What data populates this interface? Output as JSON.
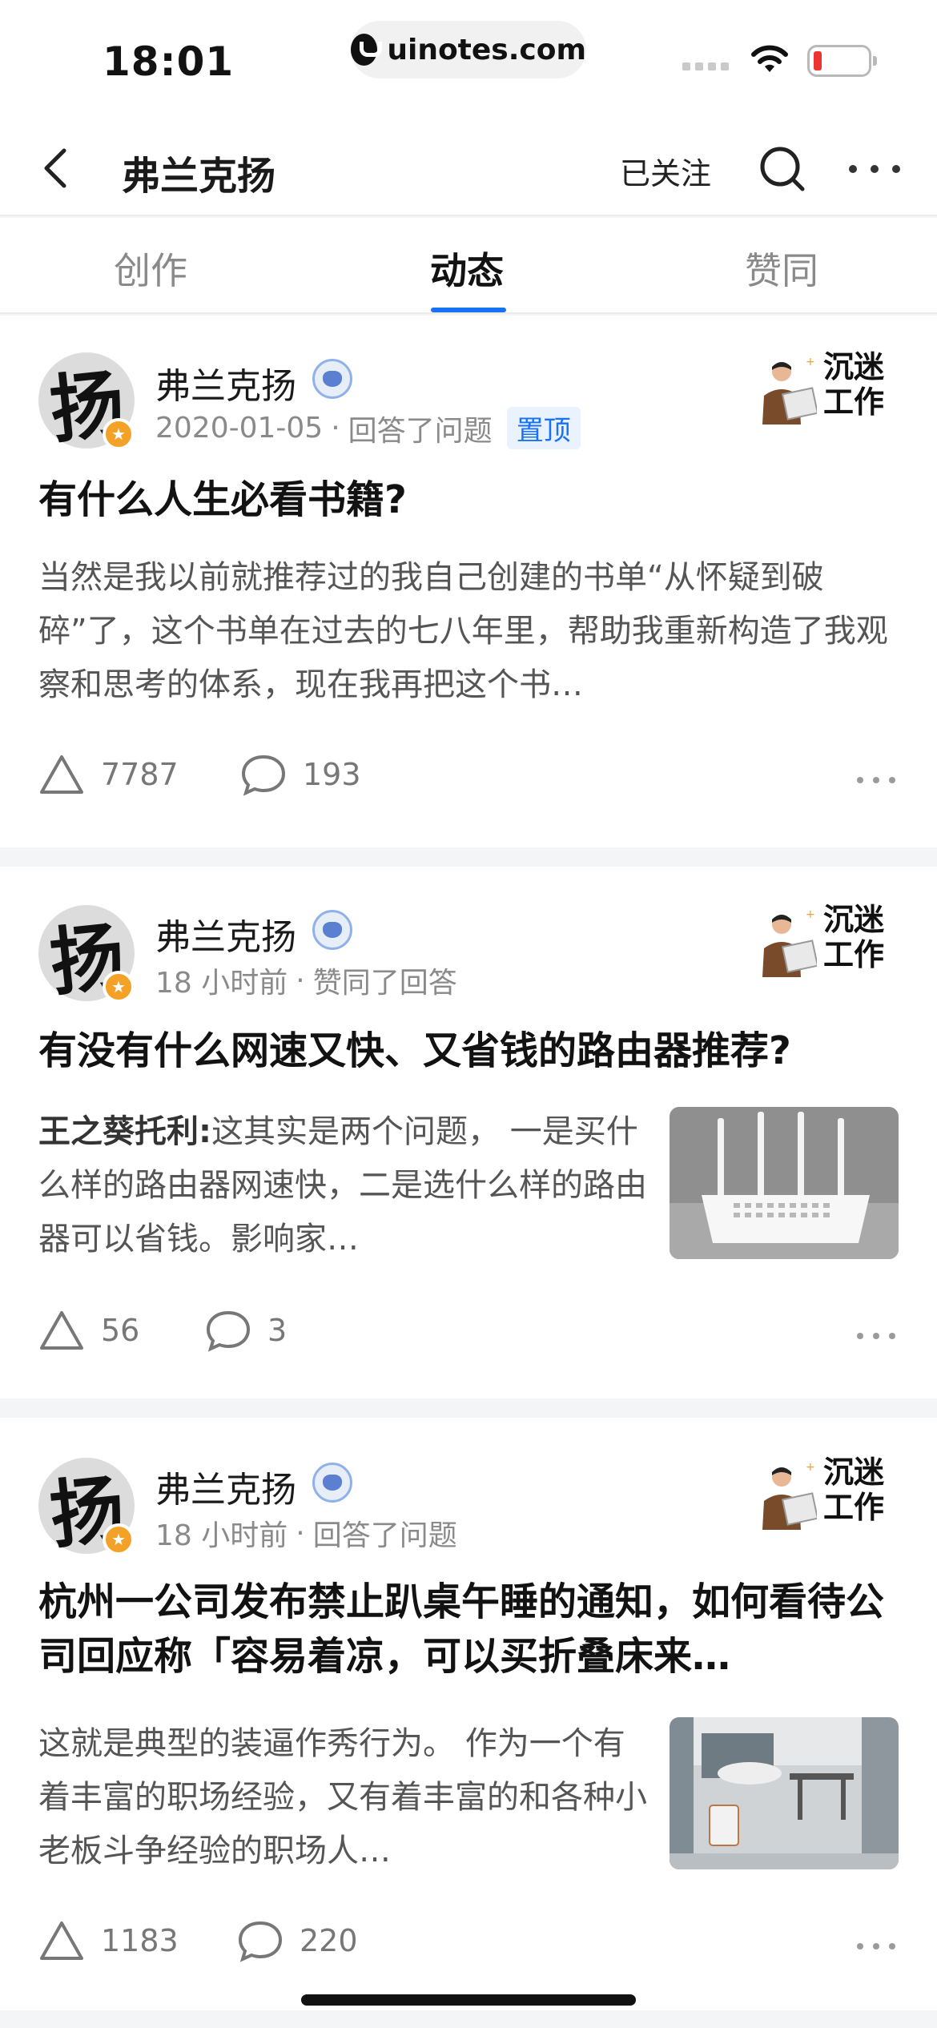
{
  "status_bar": {
    "time": "18:01",
    "url": "uinotes.com"
  },
  "nav": {
    "title": "弗兰克扬",
    "follow_label": "已关注"
  },
  "tabs": [
    {
      "label": "创作"
    },
    {
      "label": "动态",
      "active": true
    },
    {
      "label": "赞同"
    }
  ],
  "avatar_char": "扬",
  "medal_text": "沉迷\n工作",
  "posts": [
    {
      "author": "弗兰克扬",
      "date": "2020-01-05",
      "action": "回答了问题",
      "pinned_label": "置顶",
      "title": "有什么人生必看书籍?",
      "excerpt": "当然是我以前就推荐过的我自己创建的书单“从怀疑到破碎”了，这个书单在过去的七八年里，帮助我重新构造了我观察和思考的体系，现在我再把这个书…",
      "likes": "7787",
      "comments": "193"
    },
    {
      "author": "弗兰克扬",
      "date": "18 小时前",
      "action": "赞同了回答",
      "title": "有没有什么网速又快、又省钱的路由器推荐?",
      "excerpt_author": "王之葵托利:",
      "excerpt": "这其实是两个问题， 一是买什么样的路由器网速快，二是选什么样的路由器可以省钱。影响家…",
      "thumb": "router-photo",
      "likes": "56",
      "comments": "3"
    },
    {
      "author": "弗兰克扬",
      "date": "18 小时前",
      "action": "回答了问题",
      "title": "杭州一公司发布禁止趴桌午睡的通知，如何看待公司回应称「容易着凉，可以买折叠床来…",
      "excerpt": "这就是典型的装逼作秀行为。 作为一个有着丰富的职场经验，又有着丰富的和各种小老板斗争经验的职场人…",
      "thumb": "office-nap-photo",
      "likes": "1183",
      "comments": "220"
    }
  ],
  "colors": {
    "accent": "#1772f6",
    "badge": "#f4a127"
  }
}
